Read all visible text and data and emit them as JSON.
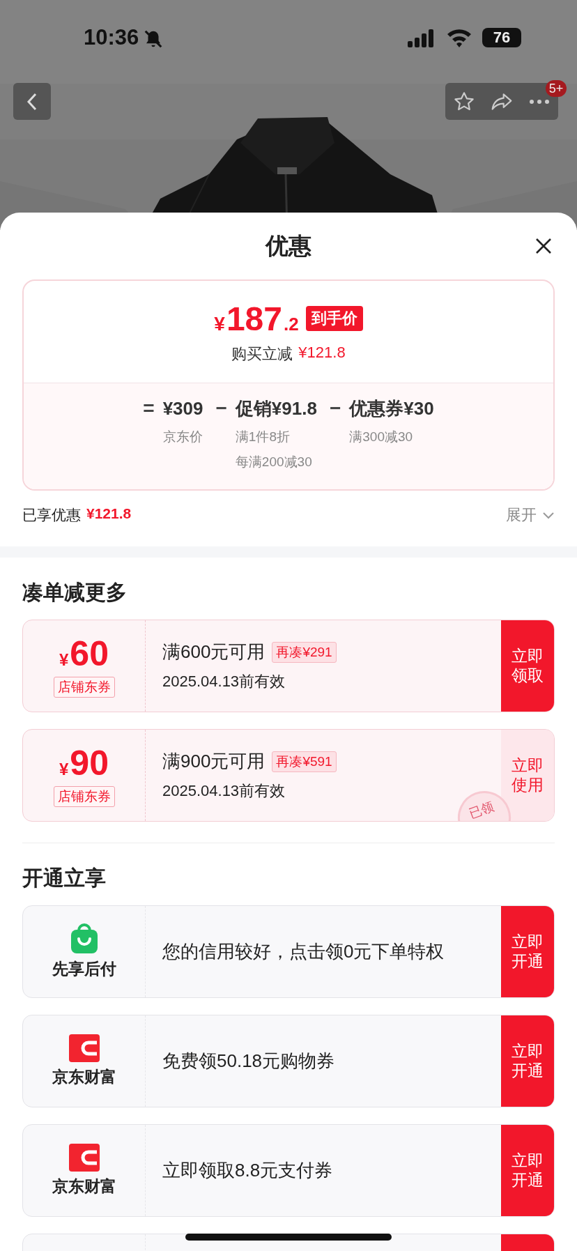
{
  "status_bar": {
    "time": "10:36",
    "battery": "76"
  },
  "top_nav": {
    "badge": "5+"
  },
  "sheet": {
    "title": "优惠"
  },
  "price_card": {
    "symbol": "¥",
    "integer": "187",
    "decimal": ".2",
    "tag": "到手价",
    "savings_label": "购买立减",
    "savings_amount": "¥121.8",
    "formula": [
      {
        "operator": "=",
        "label": "¥309",
        "notes": [
          "京东价"
        ]
      },
      {
        "operator": "−",
        "label": "促销¥91.8",
        "notes": [
          "满1件8折",
          "每满200减30"
        ]
      },
      {
        "operator": "−",
        "label": "优惠券¥30",
        "notes": [
          "满300减30"
        ]
      }
    ]
  },
  "enjoyed": {
    "label": "已享优惠",
    "amount": "¥121.8",
    "toggle": "展开",
    "expanded": false
  },
  "coupon_section": {
    "title": "凑单减更多",
    "coupons": [
      {
        "symbol": "¥",
        "amount": "60",
        "tag": "店铺东券",
        "condition": "满600元可用",
        "gap": "再凑¥291",
        "validity": "2025.04.13前有效",
        "action": "立即领取",
        "claimed": false
      },
      {
        "symbol": "¥",
        "amount": "90",
        "tag": "店铺东券",
        "condition": "满900元可用",
        "gap": "再凑¥591",
        "validity": "2025.04.13前有效",
        "action": "立即使用",
        "claimed": true,
        "stamp": "已领"
      }
    ]
  },
  "offer_section": {
    "title": "开通立享",
    "offers": [
      {
        "kind": "bag-offer",
        "brand": "先享后付",
        "text": "您的信用较好，点击领0元下单特权",
        "action": "立即开通"
      },
      {
        "kind": "wallet-offer",
        "brand": "京东财富",
        "text": "免费领50.18元购物券",
        "action": "立即开通"
      },
      {
        "kind": "wallet-offer",
        "brand": "京东财富",
        "text": "立即领取8.8元支付券",
        "action": "立即开通"
      },
      {
        "kind": "cut"
      }
    ]
  }
}
